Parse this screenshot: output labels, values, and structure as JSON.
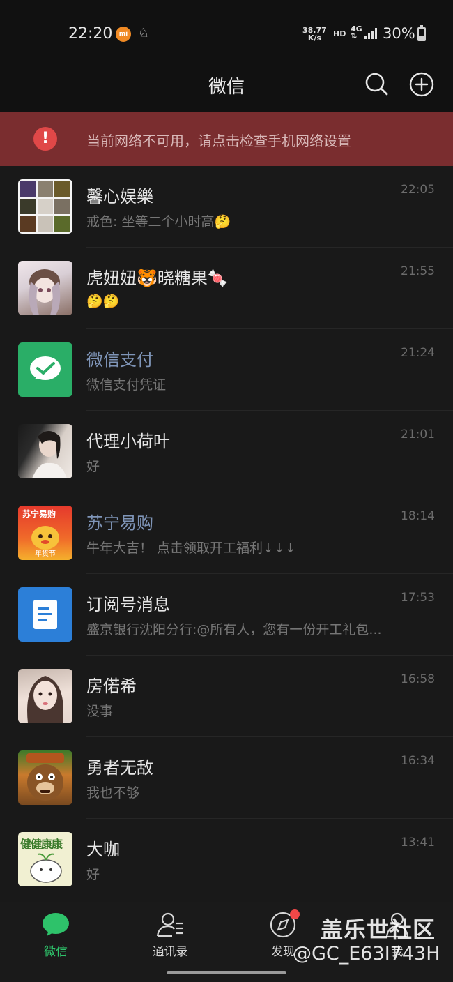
{
  "status_bar": {
    "time": "22:20",
    "app_badge": "mi",
    "net_speed_value": "38.77",
    "net_speed_unit": "K/s",
    "hd": "HD",
    "network": "4G",
    "battery": "30%"
  },
  "header": {
    "title": "微信"
  },
  "banner": {
    "icon_text": "!",
    "text": "当前网络不可用，请点击检查手机网络设置"
  },
  "chats": [
    {
      "name": "馨心娱樂",
      "message": "戒色: 坐等二个小时高🤔",
      "time": "22:05",
      "avatar": "group-avatar"
    },
    {
      "name": "虎妞妞🐯晓糖果🍬",
      "message": "🤔🤔",
      "time": "21:55",
      "avatar": "anime-girl-avatar"
    },
    {
      "name": "微信支付",
      "message": "微信支付凭证",
      "time": "21:24",
      "avatar": "wechat-pay-avatar"
    },
    {
      "name": "代理小荷叶",
      "message": "好",
      "time": "21:01",
      "avatar": "girl-photo-avatar"
    },
    {
      "name": "苏宁易购",
      "message": "牛年大吉！ 点击领取开工福利↓↓↓",
      "time": "18:14",
      "avatar": "suning-avatar",
      "avatar_text": "苏宁易购",
      "avatar_sub": "年货节"
    },
    {
      "name": "订阅号消息",
      "message": "盛京银行沈阳分行:@所有人，您有一份开工礼包...",
      "time": "17:53",
      "avatar": "subscription-avatar"
    },
    {
      "name": "房偌希",
      "message": "没事",
      "time": "16:58",
      "avatar": "girl-portrait-avatar"
    },
    {
      "name": "勇者无敌",
      "message": "我也不够",
      "time": "16:34",
      "avatar": "bear-avatar"
    },
    {
      "name": "大咖",
      "message": "好",
      "time": "13:41",
      "avatar": "health-avatar",
      "avatar_text": "健健康康"
    }
  ],
  "tabs": [
    {
      "label": "微信",
      "icon": "chat-bubble-icon",
      "active": true
    },
    {
      "label": "通讯录",
      "icon": "contacts-icon"
    },
    {
      "label": "发现",
      "icon": "compass-icon",
      "badge": true
    },
    {
      "label": "我",
      "icon": "person-icon"
    }
  ],
  "watermark": {
    "line1": "盖乐世社区",
    "line2": "@GC_E63I743H"
  },
  "colors": {
    "accent_green": "#2ec26a",
    "banner_bg": "#7a2d2f",
    "official_name": "#7f95b8"
  }
}
